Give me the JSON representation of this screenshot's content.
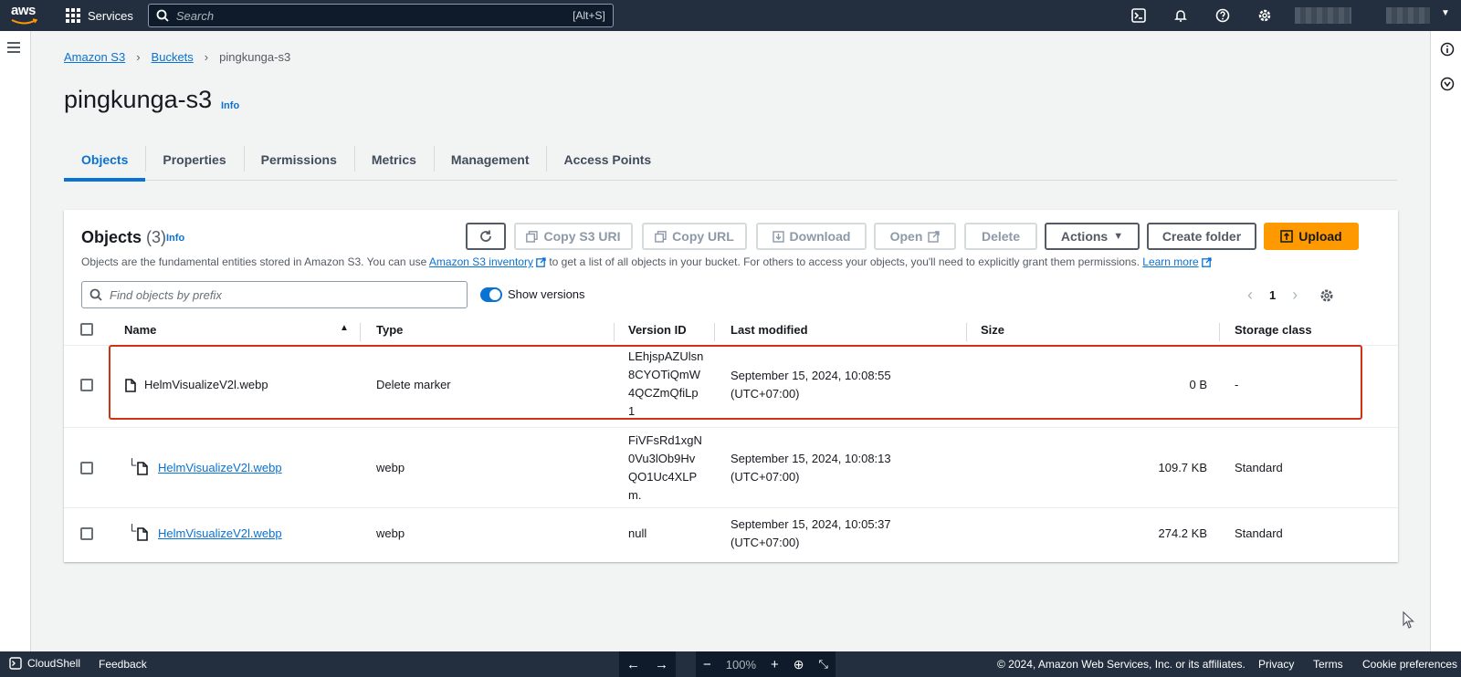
{
  "topnav": {
    "logo": "aws",
    "services_label": "Services",
    "search_placeholder": "Search",
    "search_shortcut": "[Alt+S]",
    "icons": [
      "cloudshell-icon",
      "bell-icon",
      "help-icon",
      "settings-icon"
    ]
  },
  "breadcrumb": {
    "items": [
      "Amazon S3",
      "Buckets"
    ],
    "current": "pingkunga-s3"
  },
  "page": {
    "title": "pingkunga-s3",
    "info": "Info"
  },
  "tabs": [
    "Objects",
    "Properties",
    "Permissions",
    "Metrics",
    "Management",
    "Access Points"
  ],
  "objects_panel": {
    "title": "Objects",
    "count": "(3)",
    "info": "Info",
    "buttons": {
      "copy_s3_uri": "Copy S3 URI",
      "copy_url": "Copy URL",
      "download": "Download",
      "open": "Open",
      "delete": "Delete",
      "actions": "Actions",
      "create_folder": "Create folder",
      "upload": "Upload"
    },
    "description_prefix": "Objects are the fundamental entities stored in Amazon S3. You can use",
    "inventory_link": "Amazon S3 inventory",
    "description_middle": "to get a list of all objects in your bucket. For others to access your objects, you'll need to explicitly grant them permissions.",
    "learn_more": "Learn more",
    "filter_placeholder": "Find objects by prefix",
    "show_versions_label": "Show versions",
    "show_versions_on": true,
    "page_number": "1"
  },
  "table": {
    "columns": [
      "Name",
      "Type",
      "Version ID",
      "Last modified",
      "Size",
      "Storage class"
    ],
    "rows": [
      {
        "name": "HelmVisualizeV2l.webp",
        "type": "Delete marker",
        "version_lines": [
          "LEhjspAZUlsn",
          "8CYOTiQmW",
          "4QCZmQfiLp",
          "1"
        ],
        "modified_lines": [
          "September 15, 2024, 10:08:55",
          "(UTC+07:00)"
        ],
        "size": "0 B",
        "storage": "-"
      },
      {
        "name": "HelmVisualizeV2l.webp",
        "type": "webp",
        "version_lines": [
          "FiVFsRd1xgN",
          "0Vu3lOb9Hv",
          "QO1Uc4XLP",
          "m."
        ],
        "modified_lines": [
          "September 15, 2024, 10:08:13",
          "(UTC+07:00)"
        ],
        "size": "109.7 KB",
        "storage": "Standard"
      },
      {
        "name": "HelmVisualizeV2l.webp",
        "type": "webp",
        "version_lines": [
          "null"
        ],
        "modified_lines": [
          "September 15, 2024, 10:05:37",
          "(UTC+07:00)"
        ],
        "size": "274.2 KB",
        "storage": "Standard"
      }
    ]
  },
  "footer": {
    "cloudshell": "CloudShell",
    "feedback": "Feedback",
    "zoom": "100%",
    "copyright": "© 2024, Amazon Web Services, Inc. or its affiliates.",
    "privacy": "Privacy",
    "terms": "Terms",
    "cookie": "Cookie preferences"
  },
  "colors": {
    "nav_bg": "#232f3e",
    "link": "#0972d3",
    "upload": "#ff9900",
    "highlight": "#d13212"
  }
}
